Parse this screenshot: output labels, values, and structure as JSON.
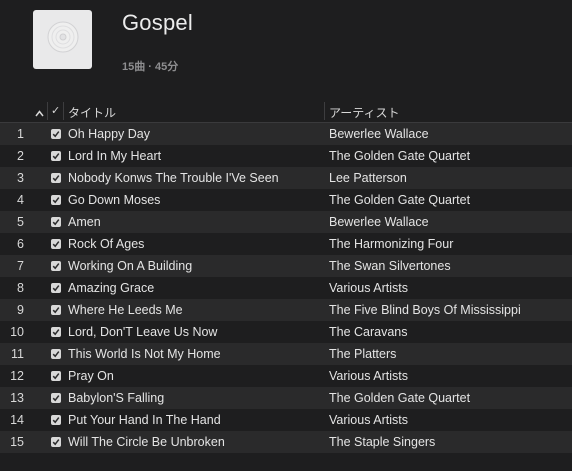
{
  "playlist": {
    "title": "Gospel",
    "meta": "15曲 · 45分",
    "artwork_icon": "disc-icon"
  },
  "columns": {
    "sort_indicator": "^",
    "check": "✓",
    "title": "タイトル",
    "artist": "アーティスト"
  },
  "tracks": [
    {
      "num": "1",
      "title": "Oh Happy Day",
      "artist": "Bewerlee Wallace",
      "checked": true
    },
    {
      "num": "2",
      "title": "Lord In My Heart",
      "artist": "The Golden Gate Quartet",
      "checked": true
    },
    {
      "num": "3",
      "title": "Nobody Konws The Trouble I'Ve Seen",
      "artist": "Lee Patterson",
      "checked": true
    },
    {
      "num": "4",
      "title": "Go Down Moses",
      "artist": "The Golden Gate Quartet",
      "checked": true
    },
    {
      "num": "5",
      "title": "Amen",
      "artist": "Bewerlee Wallace",
      "checked": true
    },
    {
      "num": "6",
      "title": "Rock Of Ages",
      "artist": "The Harmonizing Four",
      "checked": true
    },
    {
      "num": "7",
      "title": "Working On A Building",
      "artist": "The Swan Silvertones",
      "checked": true
    },
    {
      "num": "8",
      "title": "Amazing Grace",
      "artist": "Various Artists",
      "checked": true
    },
    {
      "num": "9",
      "title": "Where He Leeds Me",
      "artist": "The Five Blind Boys Of Mississippi",
      "checked": true
    },
    {
      "num": "10",
      "title": "Lord, Don'T Leave Us Now",
      "artist": "The Caravans",
      "checked": true
    },
    {
      "num": "11",
      "title": "This World Is Not My Home",
      "artist": "The Platters",
      "checked": true
    },
    {
      "num": "12",
      "title": "Pray On",
      "artist": "Various Artists",
      "checked": true
    },
    {
      "num": "13",
      "title": "Babylon'S Falling",
      "artist": "The Golden Gate Quartet",
      "checked": true
    },
    {
      "num": "14",
      "title": "Put Your Hand In The Hand",
      "artist": "Various Artists",
      "checked": true
    },
    {
      "num": "15",
      "title": "Will The Circle Be Unbroken",
      "artist": "The Staple Singers",
      "checked": true
    }
  ]
}
